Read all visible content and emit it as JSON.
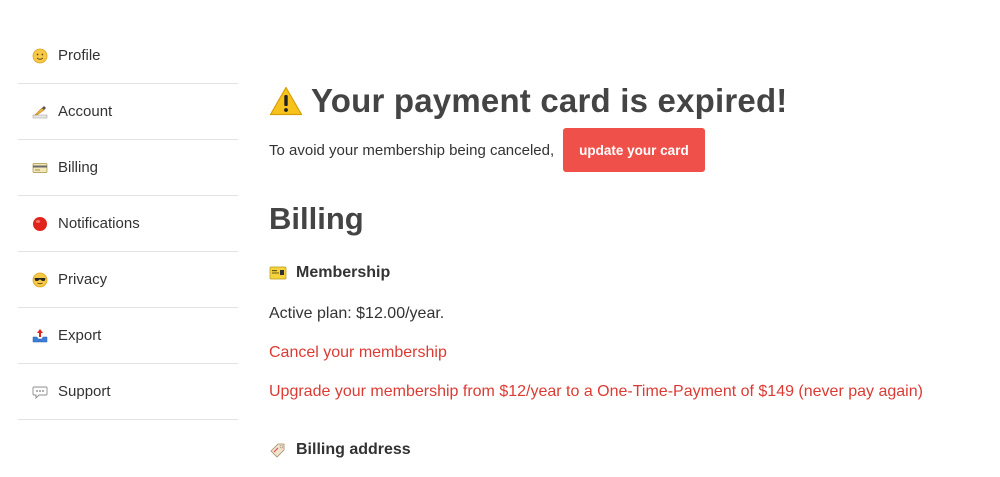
{
  "sidebar": {
    "items": [
      {
        "label": "Profile",
        "icon": "smiley-face-icon"
      },
      {
        "label": "Account",
        "icon": "writing-hand-icon"
      },
      {
        "label": "Billing",
        "icon": "credit-card-icon"
      },
      {
        "label": "Notifications",
        "icon": "red-circle-icon"
      },
      {
        "label": "Privacy",
        "icon": "sunglasses-face-icon"
      },
      {
        "label": "Export",
        "icon": "outbox-tray-icon"
      },
      {
        "label": "Support",
        "icon": "speech-bubble-icon"
      }
    ]
  },
  "alert": {
    "icon": "warning-icon",
    "title": "Your payment card is expired!",
    "notice": "To avoid your membership being canceled,",
    "button_label": "update your card"
  },
  "billing": {
    "title": "Billing",
    "membership": {
      "icon": "membership-card-icon",
      "heading": "Membership",
      "active_plan": "Active plan: $12.00/year.",
      "cancel_link": "Cancel your membership",
      "upgrade_link": "Upgrade your membership from $12/year to a One-Time-Payment of $149 (never pay again)"
    },
    "address": {
      "icon": "label-tag-icon",
      "heading": "Billing address"
    }
  },
  "colors": {
    "accent": "#f0504a",
    "link": "#dc3b34",
    "text": "#333333",
    "heading": "#444444",
    "divider": "#e3e3e3"
  }
}
